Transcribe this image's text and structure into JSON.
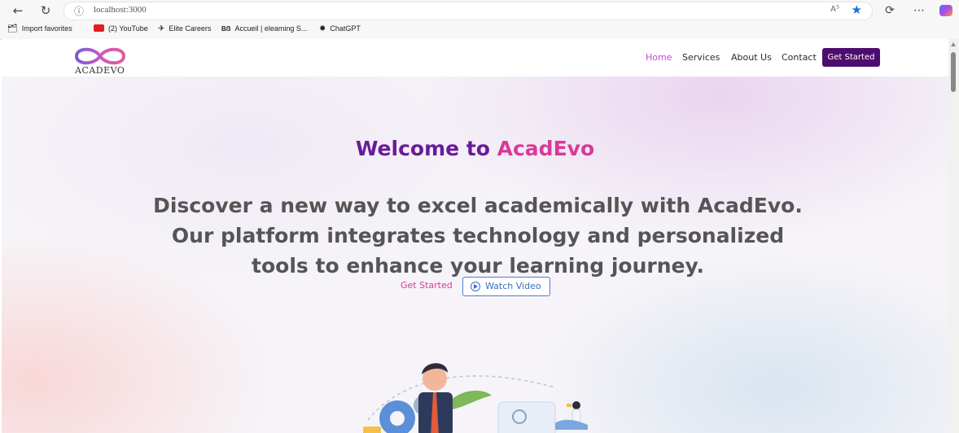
{
  "browser": {
    "url": "localhost:3000",
    "icons": [
      "back-arrow",
      "reload",
      "site-info",
      "read-aloud",
      "favorite-star",
      "extensions",
      "more",
      "copilot"
    ],
    "favorites": [
      {
        "label": "Import favorites",
        "icon": "import-icon"
      },
      {
        "label": "(2) YouTube",
        "icon": "youtube-icon"
      },
      {
        "label": "Elite Careers",
        "icon": "elite-icon"
      },
      {
        "label": "Accueil | eleaming S...",
        "icon": "eleaming-icon"
      },
      {
        "label": "ChatGPT",
        "icon": "chatgpt-icon"
      }
    ]
  },
  "site": {
    "logo_text": "ACADEVO",
    "nav": [
      "Home",
      "Services",
      "About Us",
      "Contact"
    ],
    "nav_active": "Home",
    "nav_cta": "Get Started"
  },
  "hero": {
    "welcome_prefix": "Welcome to",
    "welcome_brand": "AcadEvo",
    "tagline_lines": [
      "Discover a new way to excel academically with AcadEvo.",
      "Our platform integrates technology and personalized",
      "tools to enhance your learning journey."
    ],
    "get_started": "Get Started",
    "watch_video": "Watch Video"
  },
  "colors": {
    "accent_purple": "#6a1b9a",
    "accent_pink": "#d93a9a",
    "cta_bg": "#4d0c6e",
    "watch_border": "#4a7fd6"
  }
}
